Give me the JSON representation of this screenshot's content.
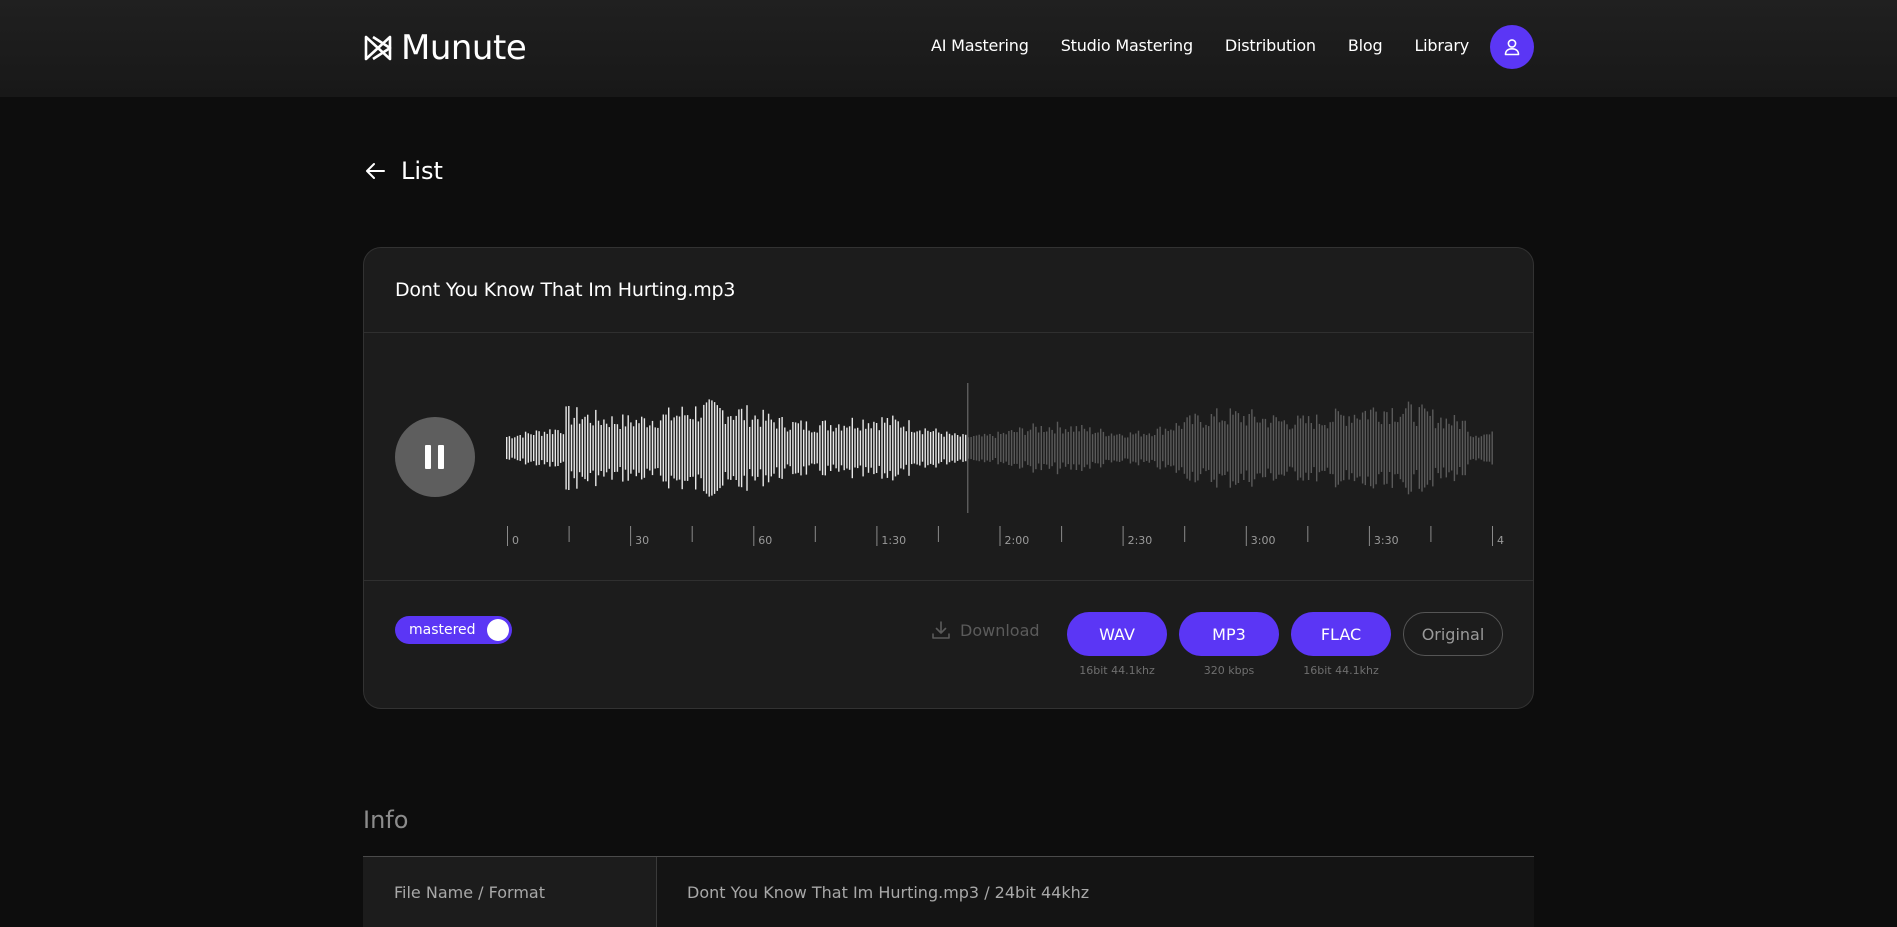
{
  "app": {
    "brand": "Munute",
    "accent": "#5b36f5"
  },
  "nav": {
    "items": [
      {
        "label": "AI Mastering"
      },
      {
        "label": "Studio Mastering"
      },
      {
        "label": "Distribution"
      },
      {
        "label": "Blog"
      },
      {
        "label": "Library"
      }
    ],
    "profile_icon": "user-icon"
  },
  "back": {
    "label": "List",
    "icon": "arrow-left-icon"
  },
  "player": {
    "track_title": "Dont You Know That Im Hurting.mp3",
    "state_icon": "pause-icon",
    "played_fraction": 0.466,
    "time_labels": [
      "0",
      "30",
      "60",
      "1:30",
      "2:00",
      "2:30",
      "3:00",
      "3:30",
      "4"
    ],
    "toggle_label": "mastered",
    "toggle_on": true
  },
  "download": {
    "label": "Download",
    "icon": "download-icon",
    "formats": [
      {
        "label": "WAV",
        "sub": "16bit 44.1khz"
      },
      {
        "label": "MP3",
        "sub": "320 kbps"
      },
      {
        "label": "FLAC",
        "sub": "16bit 44.1khz"
      }
    ],
    "original_label": "Original"
  },
  "info": {
    "title": "Info",
    "rows": [
      {
        "key": "File Name / Format",
        "value": "Dont You Know That Im Hurting.mp3 / 24bit 44khz"
      }
    ]
  }
}
